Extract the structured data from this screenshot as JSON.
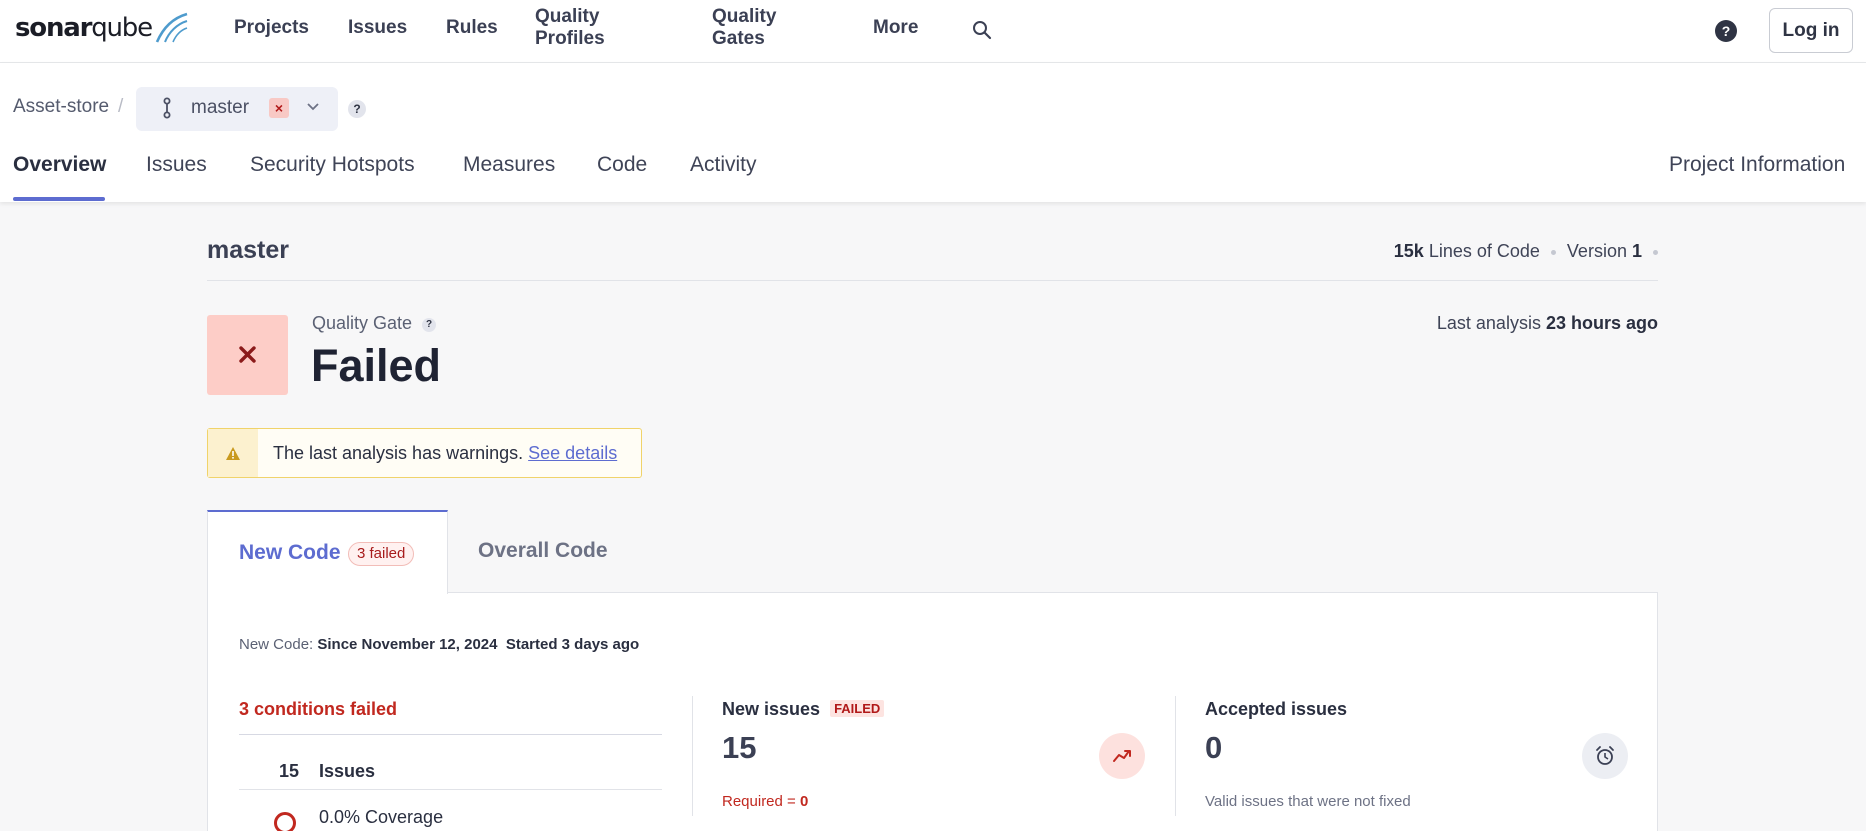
{
  "logo": {
    "brand_a": "sonar",
    "brand_b": "qube"
  },
  "nav": {
    "items": [
      "Projects",
      "Issues",
      "Rules",
      "Quality Profiles",
      "Quality Gates",
      "More"
    ],
    "login_label": "Log in",
    "help_glyph": "?"
  },
  "breadcrumb": {
    "project": "Asset-store",
    "separator": "/"
  },
  "branch": {
    "name": "master",
    "fail_glyph": "×",
    "help_glyph": "?"
  },
  "project_tabs": {
    "items": [
      "Overview",
      "Issues",
      "Security Hotspots",
      "Measures",
      "Code",
      "Activity"
    ],
    "active": "Overview",
    "right_link": "Project Information"
  },
  "overview": {
    "branch_title": "master",
    "lines_of_code_value": "15k",
    "lines_of_code_label": "Lines of Code",
    "version_label": "Version",
    "version_value": "1",
    "quality_gate_label": "Quality Gate",
    "quality_gate_status": "Failed",
    "quality_gate_glyph": "×",
    "last_analysis_label": "Last analysis",
    "last_analysis_value": "23 hours ago",
    "warning_text": "The last analysis has warnings.",
    "warning_link": "See details"
  },
  "code_tabs": {
    "new_code_label": "New Code",
    "new_code_badge": "3 failed",
    "overall_code_label": "Overall Code"
  },
  "new_code": {
    "since_label": "New Code:",
    "since_value": "Since November 12, 2024",
    "started_value": "Started 3 days ago",
    "conditions_failed": "3 conditions failed",
    "conditions": [
      {
        "value": "15",
        "label": "Issues"
      },
      {
        "label": "0.0% Coverage"
      }
    ],
    "cards": [
      {
        "title": "New issues",
        "badge": "FAILED",
        "value": "15",
        "sub_label": "Required =",
        "sub_value": "0",
        "icon": "trend-up-icon"
      },
      {
        "title": "Accepted issues",
        "value": "0",
        "sub_label": "Valid issues that were not fixed",
        "icon": "alarm-clock-icon"
      }
    ]
  },
  "colors": {
    "accent": "#5d6cd0",
    "failed_red": "#c1281f",
    "failed_bg": "#fdcdc7",
    "warning_border": "#f0d36a"
  }
}
